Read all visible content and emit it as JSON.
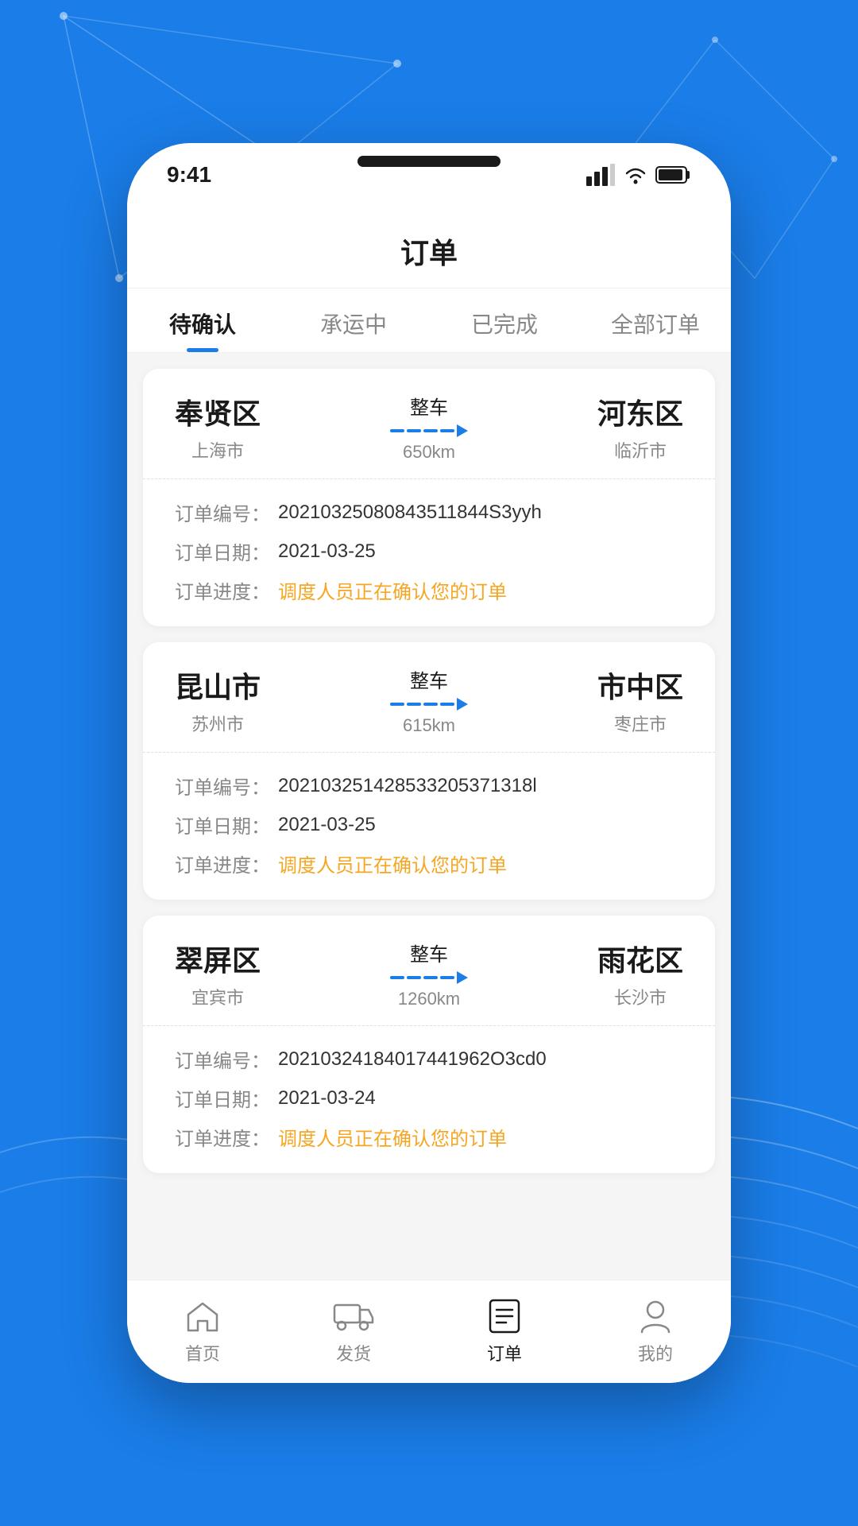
{
  "background": {
    "color": "#1a7de8"
  },
  "status_bar": {
    "time": "9:41",
    "signal": "▌▌▌",
    "wifi": "wifi",
    "battery": "battery"
  },
  "app": {
    "title": "订单"
  },
  "tabs": [
    {
      "label": "待确认",
      "active": true
    },
    {
      "label": "承运中",
      "active": false
    },
    {
      "label": "已完成",
      "active": false
    },
    {
      "label": "全部订单",
      "active": false
    }
  ],
  "orders": [
    {
      "origin_city": "奉贤区",
      "origin_province": "上海市",
      "dest_city": "河东区",
      "dest_province": "临沂市",
      "type": "整车",
      "distance": "650km",
      "order_no_label": "订单编号：",
      "order_no": "20210325080843511844S3yyh",
      "order_date_label": "订单日期：",
      "order_date": "2021-03-25",
      "order_progress_label": "订单进度：",
      "order_progress": "调度人员正在确认您的订单"
    },
    {
      "origin_city": "昆山市",
      "origin_province": "苏州市",
      "dest_city": "市中区",
      "dest_province": "枣庄市",
      "type": "整车",
      "distance": "615km",
      "order_no_label": "订单编号：",
      "order_no": "202103251428533205371318l",
      "order_date_label": "订单日期：",
      "order_date": "2021-03-25",
      "order_progress_label": "订单进度：",
      "order_progress": "调度人员正在确认您的订单"
    },
    {
      "origin_city": "翠屏区",
      "origin_province": "宜宾市",
      "dest_city": "雨花区",
      "dest_province": "长沙市",
      "type": "整车",
      "distance": "1260km",
      "order_no_label": "订单编号：",
      "order_no": "20210324184017441962O3cd0",
      "order_date_label": "订单日期：",
      "order_date": "2021-03-24",
      "order_progress_label": "订单进度：",
      "order_progress": "调度人员正在确认您的订单"
    }
  ],
  "nav": [
    {
      "label": "首页",
      "icon": "home",
      "active": false
    },
    {
      "label": "发货",
      "icon": "truck",
      "active": false
    },
    {
      "label": "订单",
      "icon": "order",
      "active": true
    },
    {
      "label": "我的",
      "icon": "user",
      "active": false
    }
  ]
}
